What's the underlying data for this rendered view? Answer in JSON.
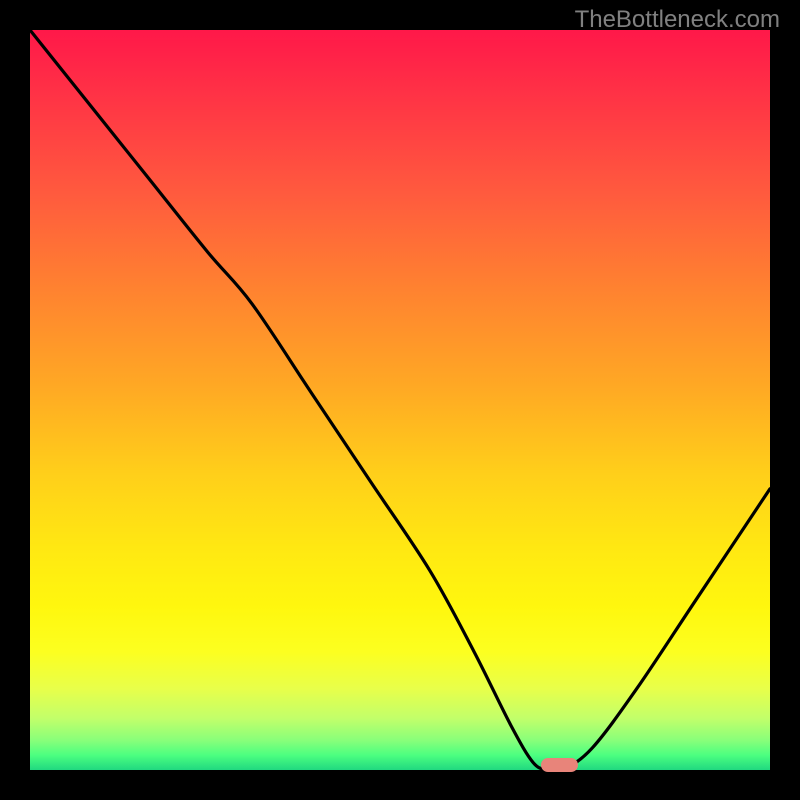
{
  "watermark": "TheBottleneck.com",
  "colors": {
    "page_bg": "#000000",
    "watermark": "#808080",
    "curve": "#000000",
    "marker": "#e8847a"
  },
  "chart_data": {
    "type": "line",
    "title": "",
    "xlabel": "",
    "ylabel": "",
    "xlim": [
      0,
      100
    ],
    "ylim": [
      0,
      100
    ],
    "grid": false,
    "legend": false,
    "series": [
      {
        "name": "bottleneck-curve",
        "x": [
          0,
          8,
          16,
          24,
          30,
          38,
          46,
          54,
          60,
          65,
          68,
          70,
          72,
          76,
          82,
          90,
          100
        ],
        "values": [
          100,
          90,
          80,
          70,
          63,
          51,
          39,
          27,
          16,
          6,
          1,
          0,
          0,
          3,
          11,
          23,
          38
        ]
      }
    ],
    "optimal_range_x": [
      69,
      74
    ],
    "annotations": []
  }
}
